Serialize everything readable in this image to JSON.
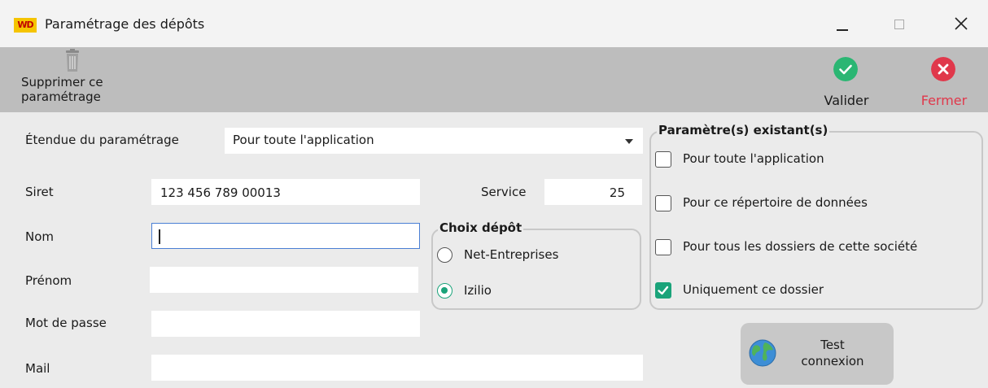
{
  "window": {
    "logo_text": "WD",
    "title": "Paramétrage des dépôts",
    "minimize_icon": "minimize-icon",
    "maximize_icon": "maximize-icon",
    "close_icon": "close-icon"
  },
  "toolbar": {
    "delete_label_line1": "Supprimer ce",
    "delete_label_line2": "paramétrage",
    "delete_icon": "trash-icon",
    "validate_label": "Valider",
    "validate_icon": "check-circle-icon",
    "close_label": "Fermer",
    "close_icon": "x-circle-icon",
    "validate_color": "#2bb673",
    "close_color": "#e0384b",
    "close_label_color": "#e0384b"
  },
  "form": {
    "scope_label": "Étendue du paramétrage",
    "scope_value": "Pour toute l'application",
    "siret_label": "Siret",
    "siret_value": "123 456 789 00013",
    "service_label": "Service",
    "service_value": "25",
    "nom_label": "Nom",
    "nom_value": "",
    "prenom_label": "Prénom",
    "prenom_value": "",
    "password_label": "Mot de passe",
    "password_value": "",
    "mail_label": "Mail",
    "mail_value": ""
  },
  "depot_choice": {
    "title": "Choix dépôt",
    "options": [
      {
        "label": "Net-Entreprises",
        "selected": false
      },
      {
        "label": "Izilio",
        "selected": true
      }
    ]
  },
  "existing_params": {
    "title": "Paramètre(s) existant(s)",
    "items": [
      {
        "label": "Pour toute l'application",
        "checked": false
      },
      {
        "label": "Pour ce répertoire de données",
        "checked": false
      },
      {
        "label": "Pour tous les dossiers de cette société",
        "checked": false
      },
      {
        "label": "Uniquement ce dossier",
        "checked": true
      }
    ]
  },
  "test_button": {
    "label_line1": "Test",
    "label_line2": "connexion",
    "icon": "globe-icon"
  },
  "colors": {
    "accent_green": "#1aa37a",
    "toolbar_bg": "#bdbdbd",
    "window_bg": "#ebebeb"
  }
}
